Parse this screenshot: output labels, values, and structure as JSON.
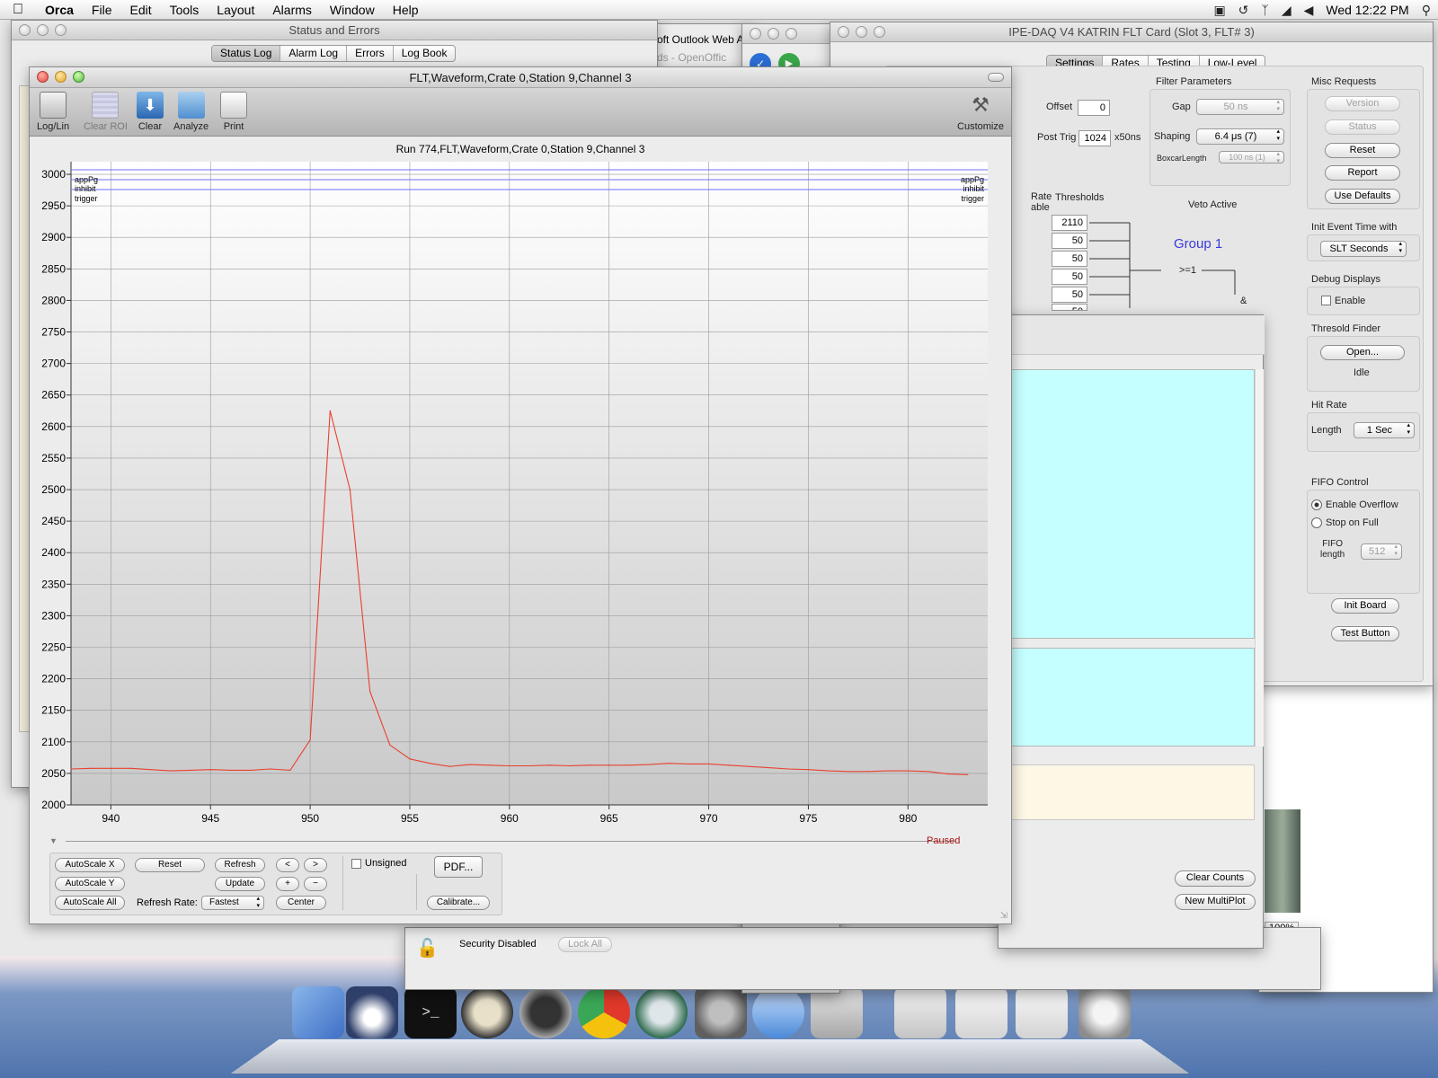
{
  "menubar": {
    "app": "Orca",
    "items": [
      "File",
      "Edit",
      "Tools",
      "Layout",
      "Alarms",
      "Window",
      "Help"
    ],
    "clock": "Wed 12:22 PM"
  },
  "status_window": {
    "title": "Status and Errors",
    "tabs": [
      "Status Log",
      "Alarm Log",
      "Errors",
      "Log Book"
    ],
    "selected_tab": "Status Log"
  },
  "background_titles": {
    "outlook": "oft Outlook Web A",
    "openoffice": "ds - OpenOffic"
  },
  "flt_card": {
    "title": "IPE-DAQ V4 KATRIN FLT Card (Slot 3, FLT# 3)",
    "tabs": [
      "Settings",
      "Rates",
      "Testing",
      "Low-Level"
    ],
    "selected_tab": "Settings",
    "offset_label": "Offset",
    "offset_value": "0",
    "post_trig_label": "Post Trig",
    "post_trig_value": "1024",
    "post_trig_unit": "x50ns",
    "filter": {
      "title": "Filter Parameters",
      "gap_label": "Gap",
      "gap_value": "50 ns",
      "shaping_label": "Shaping",
      "shaping_value": "6.4 μs (7)",
      "boxcar_label": "BoxcarLength",
      "boxcar_value": "100 ns (1)"
    },
    "rate_enable_label": "Rate\nable",
    "thresholds_label": "Thresholds",
    "thresholds": [
      "2110",
      "50",
      "50",
      "50",
      "50",
      "50"
    ],
    "veto_label": "Veto Active",
    "group_label": "Group 1",
    "logic_ge1": ">=1",
    "logic_and": "&",
    "misc": {
      "title": "Misc Requests",
      "version": "Version",
      "status": "Status",
      "reset": "Reset",
      "report": "Report",
      "use_defaults": "Use Defaults"
    },
    "init_event": {
      "title": "Init Event Time with",
      "value": "SLT Seconds"
    },
    "debug": {
      "title": "Debug Displays",
      "enable": "Enable"
    },
    "threshold_finder": {
      "title": "Thresold Finder",
      "open": "Open...",
      "status": "Idle"
    },
    "hit_rate": {
      "title": "Hit Rate",
      "length_label": "Length",
      "length_value": "1 Sec"
    },
    "fifo": {
      "title": "FIFO Control",
      "enable_overflow": "Enable Overflow",
      "stop_on_full": "Stop on Full",
      "length_label": "FIFO\nlength",
      "length_value": "512"
    },
    "init_board": "Init Board",
    "test_button": "Test Button"
  },
  "rates_panel": {
    "clear_counts": "Clear Counts",
    "new_multiplot": "New MultiPlot",
    "zoom": "100%"
  },
  "security": {
    "text": "Security Disabled",
    "lock_all": "Lock All"
  },
  "waveform": {
    "title": "FLT,Waveform,Crate  0,Station  9,Channel  3",
    "toolbar": [
      "Log/Lin",
      "Clear ROI",
      "Clear",
      "Analyze",
      "Print"
    ],
    "customize": "Customize",
    "plot_title": "Run 774,FLT,Waveform,Crate  0,Station  9,Channel  3",
    "legend": [
      "appPg",
      "inhibit",
      "trigger"
    ],
    "paused": "Paused",
    "controls": {
      "autoscale_x": "AutoScale X",
      "autoscale_y": "AutoScale Y",
      "autoscale_all": "AutoScale All",
      "reset": "Reset",
      "refresh": "Refresh",
      "update": "Update",
      "center": "Center",
      "prev": "<",
      "next": ">",
      "plus": "+",
      "minus": "−",
      "refresh_rate_label": "Refresh Rate:",
      "refresh_rate_value": "Fastest",
      "unsigned": "Unsigned",
      "pdf": "PDF...",
      "calibrate": "Calibrate..."
    }
  },
  "chart_data": {
    "type": "line",
    "title": "Run 774,FLT,Waveform,Crate  0,Station  9,Channel  3",
    "xlabel": "",
    "ylabel": "",
    "xlim": [
      938,
      984
    ],
    "ylim": [
      2000,
      3020
    ],
    "x_ticks": [
      940,
      945,
      950,
      955,
      960,
      965,
      970,
      975,
      980
    ],
    "y_ticks": [
      2000,
      2050,
      2100,
      2150,
      2200,
      2250,
      2300,
      2350,
      2400,
      2450,
      2500,
      2550,
      2600,
      2650,
      2700,
      2750,
      2800,
      2850,
      2900,
      2950,
      3000
    ],
    "grid": true,
    "line_color": "#e8412f",
    "series": [
      {
        "x": [
          938,
          939,
          940,
          941,
          942,
          943,
          944,
          945,
          946,
          947,
          948,
          949,
          950,
          951,
          952,
          953,
          954,
          955,
          956,
          957,
          958,
          959,
          960,
          961,
          962,
          963,
          964,
          965,
          966,
          967,
          968,
          969,
          970,
          971,
          972,
          973,
          974,
          975,
          976,
          977,
          978,
          979,
          980,
          981,
          982,
          983
        ],
        "y": [
          2057,
          2058,
          2058,
          2058,
          2056,
          2054,
          2055,
          2056,
          2055,
          2055,
          2057,
          2055,
          2103,
          2625,
          2500,
          2180,
          2095,
          2073,
          2066,
          2061,
          2064,
          2063,
          2062,
          2062,
          2063,
          2062,
          2063,
          2063,
          2063,
          2064,
          2066,
          2065,
          2065,
          2063,
          2061,
          2059,
          2057,
          2056,
          2054,
          2053,
          2053,
          2054,
          2054,
          2053,
          2049,
          2048
        ]
      }
    ]
  }
}
